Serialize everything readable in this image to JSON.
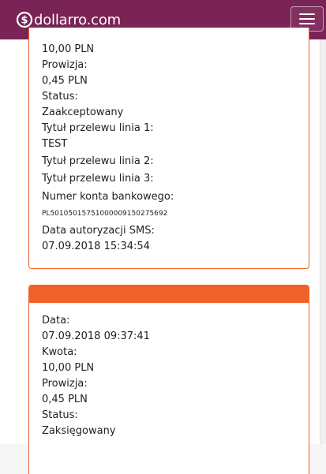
{
  "navbar": {
    "brand": "dollarro.com",
    "brand_icon": "dollar-circle-icon",
    "menu_icon": "hamburger-menu-icon",
    "bg_color": "#7a2455"
  },
  "accent_color": "#f0612a",
  "transactions": [
    {
      "lines": [
        "10,00 PLN",
        "Prowizja:",
        "0,45 PLN",
        "Status:",
        "Zaakceptowany",
        "Tytuł przelewu linia 1:",
        "TEST",
        "Tytuł przelewu linia 2:",
        "Tytuł przelewu linia 3:",
        "Numer konta bankowego:",
        "PL50105015751000009150275692",
        "Data autoryzacji SMS:",
        "07.09.2018 15:34:54"
      ]
    },
    {
      "lines": [
        "Data:",
        "07.09.2018 09:37:41",
        "Kwota:",
        "10,00 PLN",
        "Prowizja:",
        "0,45 PLN",
        "Status:",
        "Zaksięgowany"
      ]
    }
  ]
}
